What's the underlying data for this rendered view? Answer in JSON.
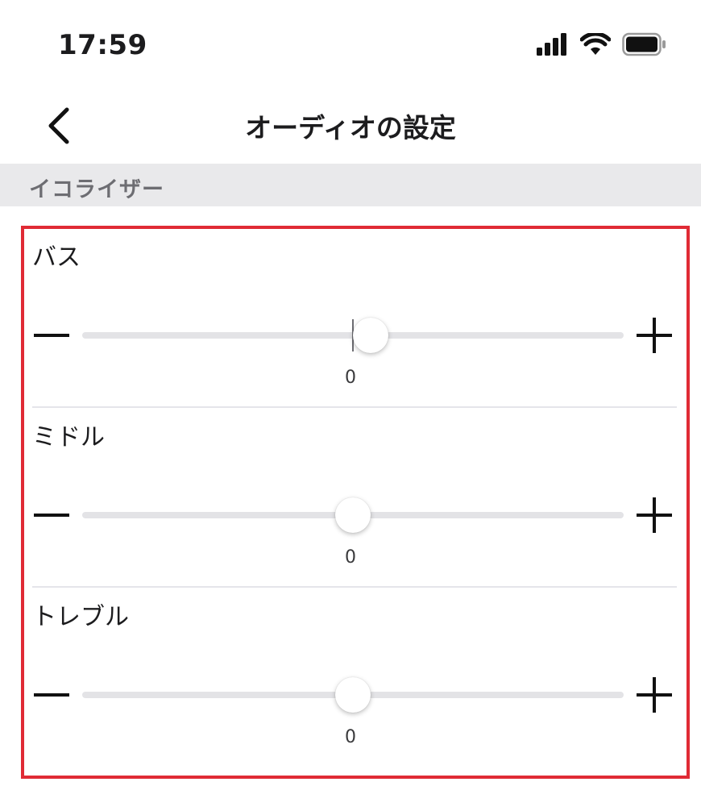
{
  "status_bar": {
    "time": "17:59",
    "signal_icon": "cellular-signal-icon",
    "wifi_icon": "wifi-icon",
    "battery_icon": "battery-icon"
  },
  "nav": {
    "back_icon": "chevron-left-icon",
    "title": "オーディオの設定"
  },
  "section": {
    "title": "イコライザー"
  },
  "equalizer": {
    "accent_color": "#e02b35",
    "bands": [
      {
        "label": "バス",
        "value": "0",
        "value_num": 0.4,
        "min": -6,
        "max": 6
      },
      {
        "label": "ミドル",
        "value": "0",
        "value_num": 0,
        "min": -6,
        "max": 6
      },
      {
        "label": "トレブル",
        "value": "0",
        "value_num": 0,
        "min": -6,
        "max": 6
      }
    ],
    "decrease_icon": "minus-icon",
    "increase_icon": "plus-icon"
  }
}
